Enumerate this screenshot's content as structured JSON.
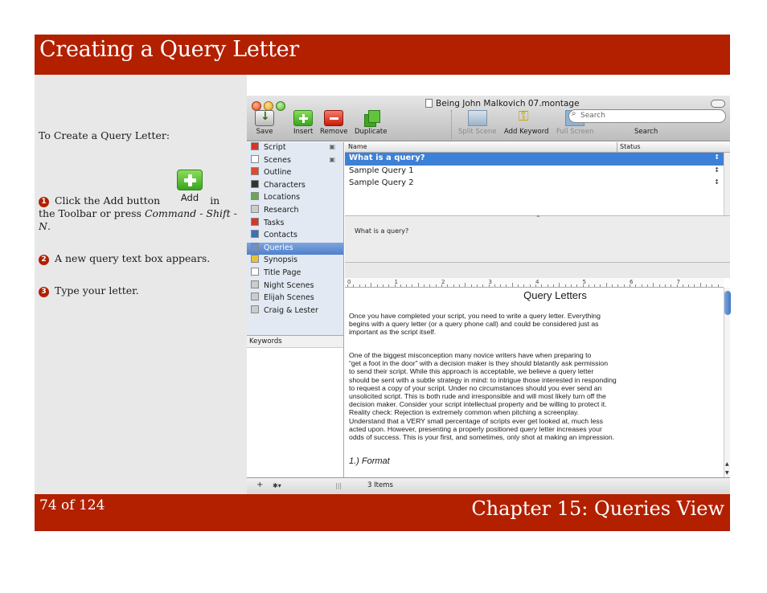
{
  "slide": {
    "title": "Creating a Query Letter",
    "page_number": "74 of 124",
    "chapter": "Chapter 15: Queries View"
  },
  "instructions": {
    "intro": "To  Create a Query Letter:",
    "step1_num": "1",
    "step1_a": "Click the Add button",
    "step1_b": "in",
    "step1_c": "the Toolbar or press",
    "step1_shortcut": "Command - Shift - N",
    "step1_end": ".",
    "add_button_label": "Add",
    "step2_num": "2",
    "step2": "A new query text box appears.",
    "step3_num": "3",
    "step3": "Type your letter."
  },
  "window": {
    "title": "Being John Malkovich 07.montage",
    "toolbar": {
      "save": "Save",
      "insert": "Insert",
      "remove": "Remove",
      "duplicate": "Duplicate",
      "split_scene": "Split Scene",
      "add_keyword": "Add Keyword",
      "full_screen": "Full Screen",
      "search_placeholder": "Search",
      "search_label": "Search"
    },
    "sidebar": [
      {
        "label": "Script",
        "icon": "script-icon",
        "color": "#d9342b"
      },
      {
        "label": "Scenes",
        "icon": "scenes-icon",
        "color": "#ffffff"
      },
      {
        "label": "Outline",
        "icon": "outline-icon",
        "color": "#e04a2a"
      },
      {
        "label": "Characters",
        "icon": "characters-icon",
        "color": "#333333"
      },
      {
        "label": "Locations",
        "icon": "locations-icon",
        "color": "#6aa84f"
      },
      {
        "label": "Research",
        "icon": "research-icon",
        "color": "#cccccc"
      },
      {
        "label": "Tasks",
        "icon": "tasks-icon",
        "color": "#d9342b"
      },
      {
        "label": "Contacts",
        "icon": "contacts-icon",
        "color": "#3d6fb6"
      },
      {
        "label": "Queries",
        "icon": "queries-icon",
        "color": "#6b8fd0"
      },
      {
        "label": "Synopsis",
        "icon": "synopsis-icon",
        "color": "#e8c33a"
      },
      {
        "label": "Title Page",
        "icon": "title-page-icon",
        "color": "#ffffff"
      },
      {
        "label": "Night Scenes",
        "icon": "smart-folder-icon",
        "color": "#cccccc"
      },
      {
        "label": "Elijah Scenes",
        "icon": "smart-folder-icon",
        "color": "#cccccc"
      },
      {
        "label": "Craig & Lester",
        "icon": "smart-folder-icon",
        "color": "#cccccc"
      }
    ],
    "keywords_header": "Keywords",
    "list": {
      "col_name": "Name",
      "col_status": "Status",
      "rows": [
        "What is a query?",
        "Sample Query 1",
        "Sample Query 2"
      ]
    },
    "synopsis_text": "What is a query?",
    "ruler_marks": [
      "0",
      "1",
      "2",
      "3",
      "4",
      "5",
      "6",
      "7"
    ],
    "editor": {
      "title": "Query Letters",
      "para1": [
        "Once you have completed your script, you need to write a query letter. Everything",
        "begins with a query letter (or a query phone call) and could be considered just as",
        "important as the script itself."
      ],
      "para2": [
        "One of the biggest misconception many novice writers have when preparing to",
        "“get a foot in the door” with a decision maker is they should blatantly ask permission",
        "to send their script. While this approach is acceptable, we believe a query letter",
        "should be sent with a subtle strategy in mind: to intrigue those interested in responding",
        "to request a copy of your script. Under no circumstances should you ever send an",
        "unsolicited script. This is both rude and irresponsible and will most likely turn off the",
        "decision maker. Consider your script intellectual property and be willing to protect it.",
        "Reality check: Rejection is extremely common when pitching a screenplay.",
        "Understand that a VERY small percentage of scripts ever get looked at, much less",
        "acted upon. However, presenting a properly positioned query letter increases your",
        "odds of success. This is your first, and sometimes, only shot at making an impression."
      ],
      "format_heading": "1.) Format"
    },
    "status": {
      "add": "+",
      "action": "✱▾",
      "split_handle": "|||",
      "items": "3 Items"
    }
  }
}
